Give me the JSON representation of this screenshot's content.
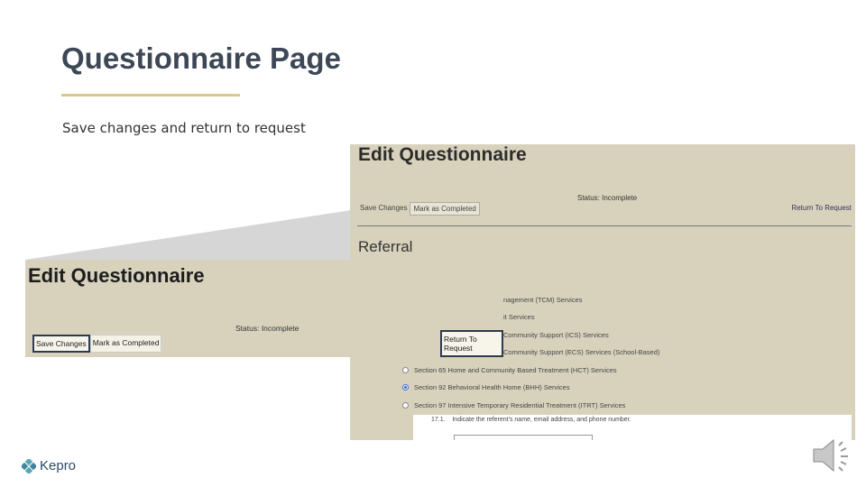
{
  "slide": {
    "title": "Questionnaire Page",
    "subtitle": "Save changes and return to request"
  },
  "screenshot": {
    "title": "Edit Questionnaire",
    "status": "Status: Incomplete",
    "save_changes": "Save Changes",
    "mark_completed": "Mark as Completed",
    "return_to_request": "Return To Request",
    "section_heading": "Referral",
    "options_partial": [
      "nagement (TCM) Services",
      "it Services",
      "Community Support (ICS) Services",
      "Community Support (ECS) Services (School-Based)"
    ],
    "radio_options": [
      {
        "label": "Section 65 Home and Community Based Treatment (HCT) Services",
        "selected": false
      },
      {
        "label": "Section 92 Behavioral Health Home (BHH) Services",
        "selected": true
      },
      {
        "label": "Section 97 Intensive Temporary Residential Treatment (ITRT) Services",
        "selected": false
      }
    ],
    "question_number": "17.1.",
    "question_text": "Indicate the referent's name, email address, and phone number."
  },
  "logo": {
    "text": "Kepro",
    "color": "#2d4a6a"
  },
  "colors": {
    "accent_rule": "#d9c98a",
    "highlight_border": "#2e3a4f",
    "screenshot_bg": "#d8d2bd"
  },
  "icons": {
    "speaker": "speaker-icon",
    "logo_mark": "kepro-logo-icon"
  }
}
